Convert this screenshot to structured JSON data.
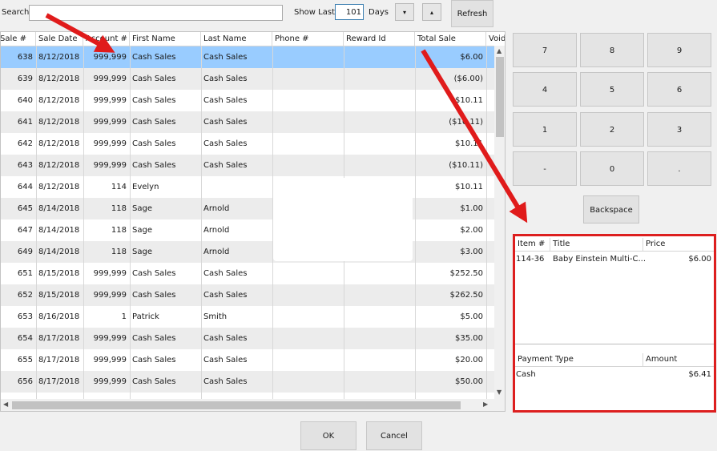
{
  "toolbar": {
    "search_label": "Search",
    "search_value": "",
    "show_last_label": "Show Last",
    "days_value": "101",
    "days_label": "Days",
    "down_label": "▾",
    "up_label": "▴",
    "refresh_label": "Refresh"
  },
  "grid": {
    "columns": [
      "Sale #",
      "Sale Date",
      "Account #",
      "First Name",
      "Last Name",
      "Phone #",
      "Reward Id",
      "Total Sale",
      "Void"
    ],
    "rows": [
      {
        "sale": "638",
        "date": "8/12/2018",
        "account": "999,999",
        "first": "Cash Sales",
        "last": "Cash Sales",
        "phone": "",
        "reward": "",
        "total": "$6.00"
      },
      {
        "sale": "639",
        "date": "8/12/2018",
        "account": "999,999",
        "first": "Cash Sales",
        "last": "Cash Sales",
        "phone": "",
        "reward": "",
        "total": "($6.00)"
      },
      {
        "sale": "640",
        "date": "8/12/2018",
        "account": "999,999",
        "first": "Cash Sales",
        "last": "Cash Sales",
        "phone": "",
        "reward": "",
        "total": "$10.11"
      },
      {
        "sale": "641",
        "date": "8/12/2018",
        "account": "999,999",
        "first": "Cash Sales",
        "last": "Cash Sales",
        "phone": "",
        "reward": "",
        "total": "($10.11)"
      },
      {
        "sale": "642",
        "date": "8/12/2018",
        "account": "999,999",
        "first": "Cash Sales",
        "last": "Cash Sales",
        "phone": "",
        "reward": "",
        "total": "$10.11"
      },
      {
        "sale": "643",
        "date": "8/12/2018",
        "account": "999,999",
        "first": "Cash Sales",
        "last": "Cash Sales",
        "phone": "",
        "reward": "",
        "total": "($10.11)"
      },
      {
        "sale": "644",
        "date": "8/12/2018",
        "account": "114",
        "first": "Evelyn",
        "last": "",
        "phone": "",
        "reward": "",
        "total": "$10.11"
      },
      {
        "sale": "645",
        "date": "8/14/2018",
        "account": "118",
        "first": "Sage",
        "last": "Arnold",
        "phone": "",
        "reward": "",
        "total": "$1.00"
      },
      {
        "sale": "647",
        "date": "8/14/2018",
        "account": "118",
        "first": "Sage",
        "last": "Arnold",
        "phone": "",
        "reward": "",
        "total": "$2.00"
      },
      {
        "sale": "649",
        "date": "8/14/2018",
        "account": "118",
        "first": "Sage",
        "last": "Arnold",
        "phone": "",
        "reward": "",
        "total": "$3.00"
      },
      {
        "sale": "651",
        "date": "8/15/2018",
        "account": "999,999",
        "first": "Cash Sales",
        "last": "Cash Sales",
        "phone": "",
        "reward": "",
        "total": "$252.50"
      },
      {
        "sale": "652",
        "date": "8/15/2018",
        "account": "999,999",
        "first": "Cash Sales",
        "last": "Cash Sales",
        "phone": "",
        "reward": "",
        "total": "$262.50"
      },
      {
        "sale": "653",
        "date": "8/16/2018",
        "account": "1",
        "first": "Patrick",
        "last": "Smith",
        "phone": "",
        "reward": "",
        "total": "$5.00"
      },
      {
        "sale": "654",
        "date": "8/17/2018",
        "account": "999,999",
        "first": "Cash Sales",
        "last": "Cash Sales",
        "phone": "",
        "reward": "",
        "total": "$35.00"
      },
      {
        "sale": "655",
        "date": "8/17/2018",
        "account": "999,999",
        "first": "Cash Sales",
        "last": "Cash Sales",
        "phone": "",
        "reward": "",
        "total": "$20.00"
      },
      {
        "sale": "656",
        "date": "8/17/2018",
        "account": "999,999",
        "first": "Cash Sales",
        "last": "Cash Sales",
        "phone": "",
        "reward": "",
        "total": "$50.00"
      }
    ],
    "selected_row": 0
  },
  "keypad": {
    "keys": [
      "7",
      "8",
      "9",
      "4",
      "5",
      "6",
      "1",
      "2",
      "3",
      "-",
      "0",
      "."
    ],
    "backspace_label": "Backspace"
  },
  "items_table": {
    "columns": [
      "Item #",
      "Title",
      "Price"
    ],
    "rows": [
      {
        "item": "114-36",
        "title": "Baby Einstein Multi-C...",
        "price": "$6.00"
      }
    ]
  },
  "payments_table": {
    "columns": [
      "Payment Type",
      "Amount"
    ],
    "rows": [
      {
        "type": "Cash",
        "amount": "$6.41"
      }
    ]
  },
  "footer": {
    "ok_label": "OK",
    "cancel_label": "Cancel"
  },
  "colors": {
    "selection": "#99ccff",
    "highlight_border": "#dd1f1f",
    "arrow": "#e01b1b"
  },
  "icons": {
    "scroll_up": "chevron-up-icon",
    "scroll_down": "chevron-down-icon",
    "scroll_left": "chevron-left-icon",
    "scroll_right": "chevron-right-icon"
  }
}
